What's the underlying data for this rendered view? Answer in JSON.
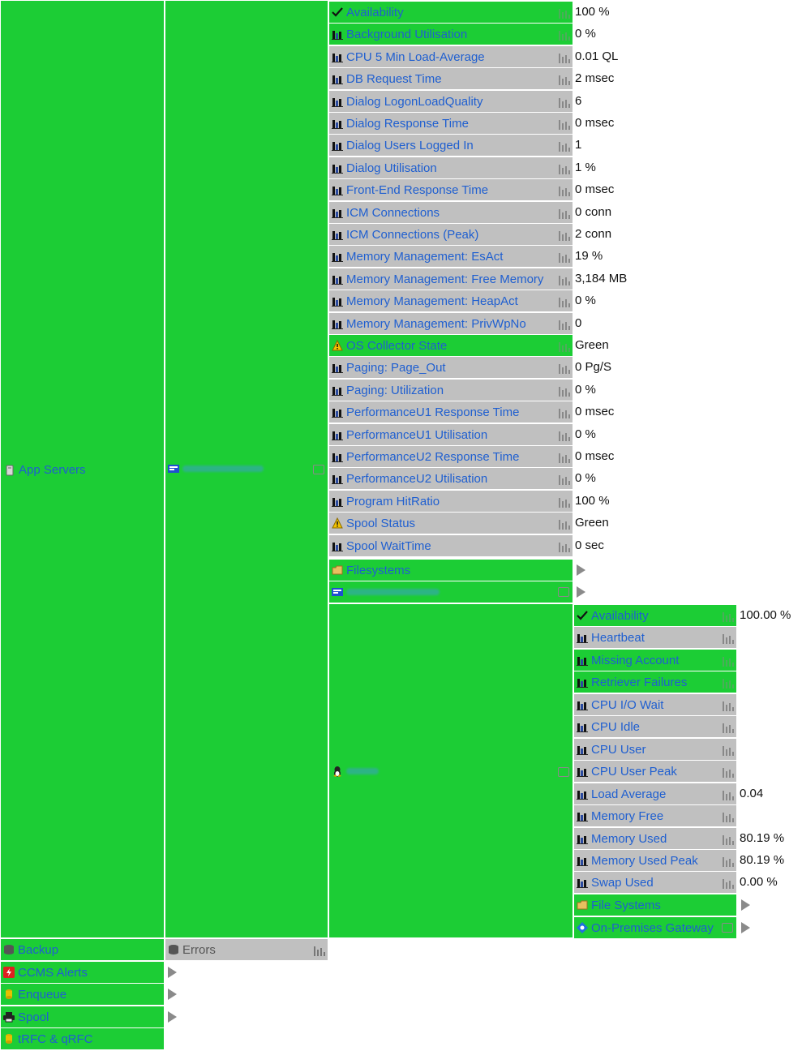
{
  "colors": {
    "green": "#1ccd35",
    "grey": "#c0c0c0",
    "link": "#1f5fd0"
  },
  "col1": {
    "app_servers": "App Servers",
    "backup": "Backup",
    "ccms": "CCMS Alerts",
    "enqueue": "Enqueue",
    "spool": "Spool",
    "trfc": "tRFC & qRFC"
  },
  "col2": {
    "server_label_redacted": true,
    "errors": "Errors"
  },
  "metrics": [
    {
      "label": "Availability",
      "value": "100 %",
      "icon": "check-icon",
      "bg": "green"
    },
    {
      "label": "Background Utilisation",
      "value": "0 %",
      "icon": "chart-icon",
      "bg": "green"
    },
    {
      "label": "CPU 5 Min Load-Average",
      "value": "0.01 QL",
      "icon": "chart-icon",
      "bg": "grey"
    },
    {
      "label": "DB Request Time",
      "value": "2 msec",
      "icon": "chart-icon",
      "bg": "grey"
    },
    {
      "label": "Dialog LogonLoadQuality",
      "value": "6",
      "icon": "chart-icon",
      "bg": "grey"
    },
    {
      "label": "Dialog Response Time",
      "value": "0 msec",
      "icon": "chart-icon",
      "bg": "grey"
    },
    {
      "label": "Dialog Users Logged In",
      "value": "1",
      "icon": "chart-icon",
      "bg": "grey"
    },
    {
      "label": "Dialog Utilisation",
      "value": "1 %",
      "icon": "chart-icon",
      "bg": "grey"
    },
    {
      "label": "Front-End Response Time",
      "value": "0 msec",
      "icon": "chart-icon",
      "bg": "grey"
    },
    {
      "label": "ICM Connections",
      "value": "0 conn",
      "icon": "chart-icon",
      "bg": "grey"
    },
    {
      "label": "ICM Connections (Peak)",
      "value": "2 conn",
      "icon": "chart-icon",
      "bg": "grey"
    },
    {
      "label": "Memory Management: EsAct",
      "value": "19 %",
      "icon": "chart-icon",
      "bg": "grey"
    },
    {
      "label": "Memory Management: Free Memory",
      "value": "3,184 MB",
      "icon": "chart-icon",
      "bg": "grey"
    },
    {
      "label": "Memory Management: HeapAct",
      "value": "0 %",
      "icon": "chart-icon",
      "bg": "grey"
    },
    {
      "label": "Memory Management: PrivWpNo",
      "value": "0",
      "icon": "chart-icon",
      "bg": "grey"
    },
    {
      "label": "OS Collector State",
      "value": "Green",
      "icon": "warning-icon",
      "bg": "green"
    },
    {
      "label": "Paging: Page_Out",
      "value": "0 Pg/S",
      "icon": "chart-icon",
      "bg": "grey"
    },
    {
      "label": "Paging: Utilization",
      "value": "0 %",
      "icon": "chart-icon",
      "bg": "grey"
    },
    {
      "label": "PerformanceU1 Response Time",
      "value": "0 msec",
      "icon": "chart-icon",
      "bg": "grey"
    },
    {
      "label": "PerformanceU1 Utilisation",
      "value": "0 %",
      "icon": "chart-icon",
      "bg": "grey"
    },
    {
      "label": "PerformanceU2 Response Time",
      "value": "0 msec",
      "icon": "chart-icon",
      "bg": "grey"
    },
    {
      "label": "PerformanceU2 Utilisation",
      "value": "0 %",
      "icon": "chart-icon",
      "bg": "grey"
    },
    {
      "label": "Program HitRatio",
      "value": "100 %",
      "icon": "chart-icon",
      "bg": "grey"
    },
    {
      "label": "Spool Status",
      "value": "Green",
      "icon": "warning-icon",
      "bg": "grey"
    },
    {
      "label": "Spool WaitTime",
      "value": "0 sec",
      "icon": "chart-icon",
      "bg": "grey"
    }
  ],
  "filesystems": "Filesystems",
  "host_metrics": [
    {
      "label": "Availability",
      "value": "100.00 %",
      "icon": "check-icon",
      "bg": "green"
    },
    {
      "label": "Heartbeat",
      "value": "",
      "icon": "chart-icon",
      "bg": "grey"
    },
    {
      "label": "Missing Account",
      "value": "",
      "icon": "chart-icon",
      "bg": "green"
    },
    {
      "label": "Retriever Failures",
      "value": "",
      "icon": "chart-icon",
      "bg": "green"
    },
    {
      "label": "CPU I/O Wait",
      "value": "",
      "icon": "chart-icon",
      "bg": "grey"
    },
    {
      "label": "CPU Idle",
      "value": "",
      "icon": "chart-icon",
      "bg": "grey"
    },
    {
      "label": "CPU User",
      "value": "",
      "icon": "chart-icon",
      "bg": "grey"
    },
    {
      "label": "CPU User Peak",
      "value": "",
      "icon": "chart-icon",
      "bg": "grey"
    },
    {
      "label": "Load Average",
      "value": "0.04",
      "icon": "chart-icon",
      "bg": "grey"
    },
    {
      "label": "Memory Free",
      "value": "",
      "icon": "chart-icon",
      "bg": "grey"
    },
    {
      "label": "Memory Used",
      "value": "80.19 %",
      "icon": "chart-icon",
      "bg": "grey"
    },
    {
      "label": "Memory Used Peak",
      "value": "80.19 %",
      "icon": "chart-icon",
      "bg": "grey"
    },
    {
      "label": "Swap Used",
      "value": "0.00 %",
      "icon": "chart-icon",
      "bg": "grey"
    }
  ],
  "file_systems": "File Systems",
  "gateway": "On-Premises Gateway"
}
